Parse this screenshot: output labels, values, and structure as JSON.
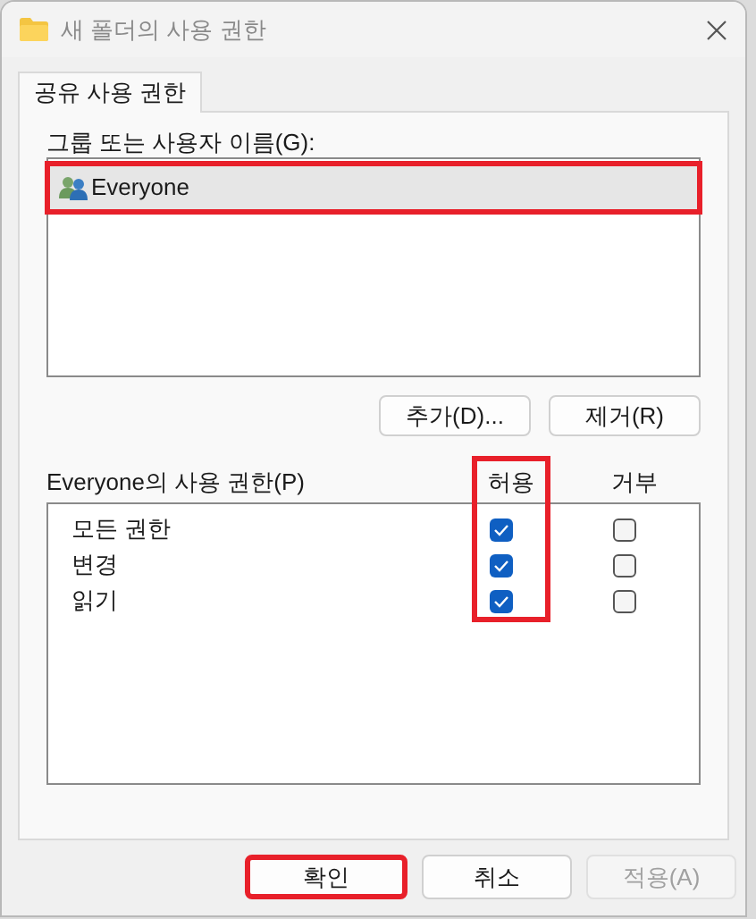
{
  "window": {
    "title": "새 폴더의 사용 권한"
  },
  "tabs": [
    {
      "label": "공유 사용 권한",
      "selected": true
    }
  ],
  "groups": {
    "label": "그룹 또는 사용자 이름(G):",
    "items": [
      {
        "name": "Everyone",
        "selected": true,
        "highlighted": true
      }
    ]
  },
  "group_buttons": [
    {
      "label": "추가(D)..."
    },
    {
      "label": "제거(R)"
    }
  ],
  "permissions": {
    "label": "Everyone의 사용 권한(P)",
    "columns": [
      {
        "label": "허용",
        "highlighted": true
      },
      {
        "label": "거부",
        "highlighted": false
      }
    ],
    "rows": [
      {
        "name": "모든 권한",
        "allow": true,
        "deny": false
      },
      {
        "name": "변경",
        "allow": true,
        "deny": false
      },
      {
        "name": "읽기",
        "allow": true,
        "deny": false
      }
    ]
  },
  "buttons": [
    {
      "label": "확인",
      "highlighted": true,
      "disabled": false
    },
    {
      "label": "취소",
      "highlighted": false,
      "disabled": false
    },
    {
      "label": "적용(A)",
      "highlighted": false,
      "disabled": true
    }
  ]
}
